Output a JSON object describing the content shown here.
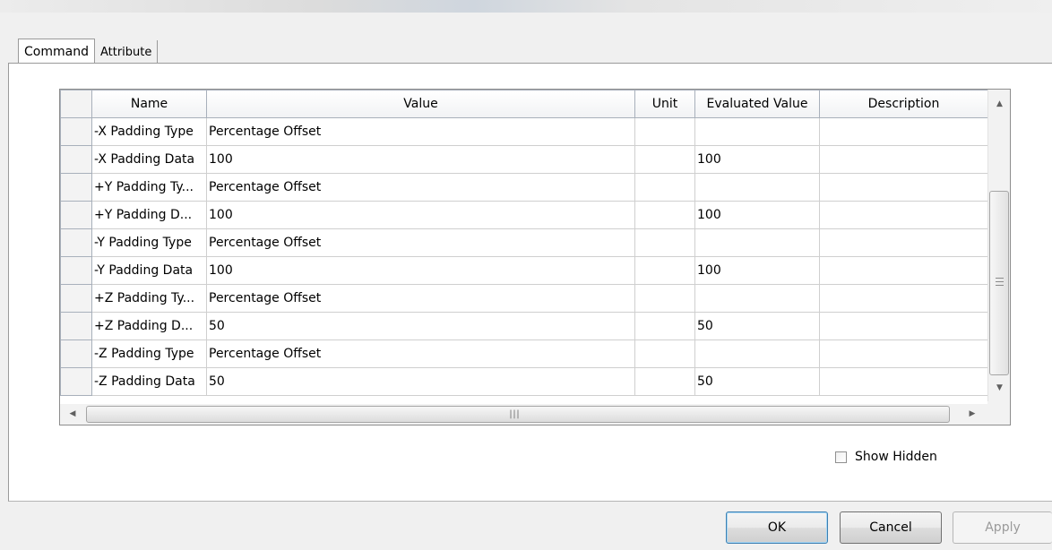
{
  "tabs": [
    {
      "label": "Command",
      "active": true
    },
    {
      "label": "Attribute",
      "active": false
    }
  ],
  "table": {
    "columns": [
      "Name",
      "Value",
      "Unit",
      "Evaluated Value",
      "Description"
    ],
    "rows": [
      {
        "name": "-X Padding Type",
        "value": "Percentage Offset",
        "unit": "",
        "evaluated": "",
        "description": ""
      },
      {
        "name": "-X Padding Data",
        "value": "100",
        "unit": "",
        "evaluated": "100",
        "description": ""
      },
      {
        "name": "+Y Padding Ty...",
        "value": "Percentage Offset",
        "unit": "",
        "evaluated": "",
        "description": ""
      },
      {
        "name": "+Y Padding D...",
        "value": "100",
        "unit": "",
        "evaluated": "100",
        "description": ""
      },
      {
        "name": "-Y Padding Type",
        "value": "Percentage Offset",
        "unit": "",
        "evaluated": "",
        "description": ""
      },
      {
        "name": "-Y Padding Data",
        "value": "100",
        "unit": "",
        "evaluated": "100",
        "description": ""
      },
      {
        "name": "+Z Padding Ty...",
        "value": "Percentage Offset",
        "unit": "",
        "evaluated": "",
        "description": ""
      },
      {
        "name": "+Z Padding D...",
        "value": "50",
        "unit": "",
        "evaluated": "50",
        "description": ""
      },
      {
        "name": "-Z Padding Type",
        "value": "Percentage Offset",
        "unit": "",
        "evaluated": "",
        "description": ""
      },
      {
        "name": "-Z Padding Data",
        "value": "50",
        "unit": "",
        "evaluated": "50",
        "description": ""
      }
    ]
  },
  "show_hidden": {
    "label": "Show Hidden",
    "checked": false
  },
  "buttons": {
    "ok": "OK",
    "cancel": "Cancel",
    "apply": "Apply"
  },
  "icons": {
    "scroll_up": "scroll-up-arrow",
    "scroll_down": "scroll-down-arrow",
    "scroll_left": "scroll-left-arrow",
    "scroll_right": "scroll-right-arrow"
  },
  "colors": {
    "ok_border": "#3c7fb1",
    "disabled_text": "#9a9a9a"
  }
}
